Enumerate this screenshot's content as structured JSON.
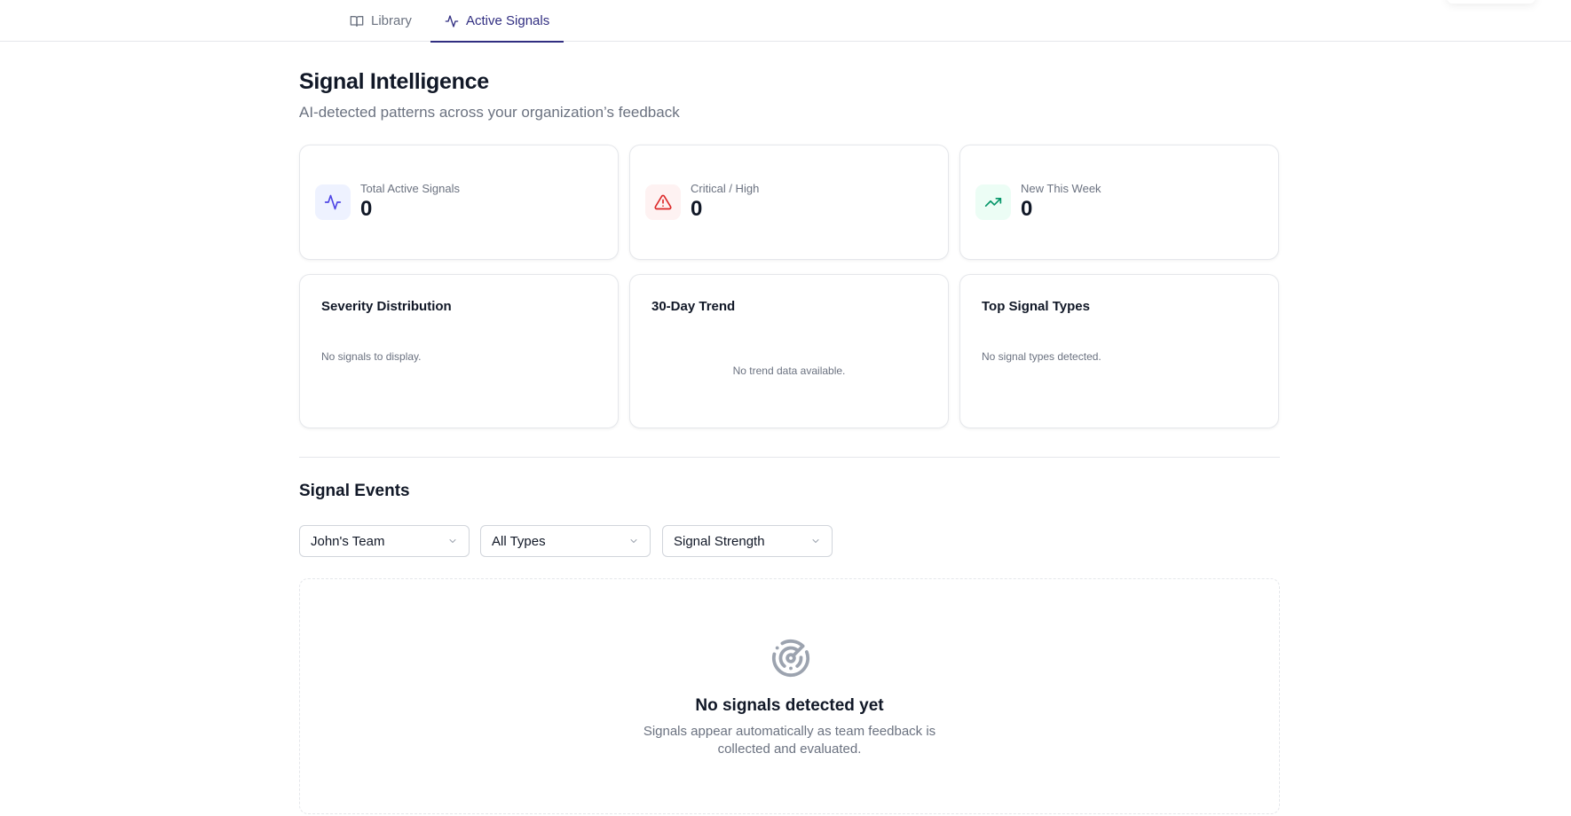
{
  "tabs": [
    {
      "label": "Library",
      "icon": "book-icon",
      "active": false
    },
    {
      "label": "Active Signals",
      "icon": "activity-icon",
      "active": true
    }
  ],
  "header": {
    "title": "Signal Intelligence",
    "subtitle": "AI-detected patterns across your organization’s feedback"
  },
  "stats": [
    {
      "label": "Total Active Signals",
      "value": "0",
      "icon": "activity-icon",
      "color": "#4f46e5"
    },
    {
      "label": "Critical / High",
      "value": "0",
      "icon": "alert-triangle-icon",
      "color": "#dc2626"
    },
    {
      "label": "New This Week",
      "value": "0",
      "icon": "trending-up-icon",
      "color": "#059669"
    }
  ],
  "panels": [
    {
      "title": "Severity Distribution",
      "empty": "No signals to display."
    },
    {
      "title": "30-Day Trend",
      "empty": "No trend data available."
    },
    {
      "title": "Top Signal Types",
      "empty": "No signal types detected."
    }
  ],
  "events": {
    "title": "Signal Events",
    "filters": [
      {
        "value": "John's Team"
      },
      {
        "value": "All Types"
      },
      {
        "value": "Signal Strength"
      }
    ],
    "empty": {
      "icon": "radar-icon",
      "title": "No signals detected yet",
      "description_line1": "Signals appear automatically as team feedback is",
      "description_line2": "collected and evaluated."
    }
  }
}
